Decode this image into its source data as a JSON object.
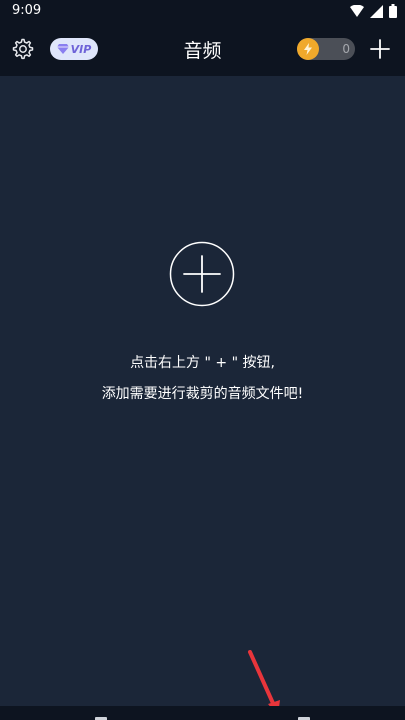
{
  "status": {
    "time": "9:09"
  },
  "header": {
    "title": "音频",
    "vip_label": "VIP",
    "coin_count": "0",
    "icons": [
      "gear-icon",
      "diamond-icon",
      "lightning-icon",
      "plus-icon"
    ]
  },
  "empty_state": {
    "line1": "点击右上方 \" + \" 按钮,",
    "line2": "添加需要进行裁剪的音频文件吧!"
  },
  "colors": {
    "background": "#1b2638",
    "bar": "#0d1420",
    "coin": "#f0a92b",
    "vip_text": "#6e63d8",
    "arrow": "#e8353b"
  }
}
